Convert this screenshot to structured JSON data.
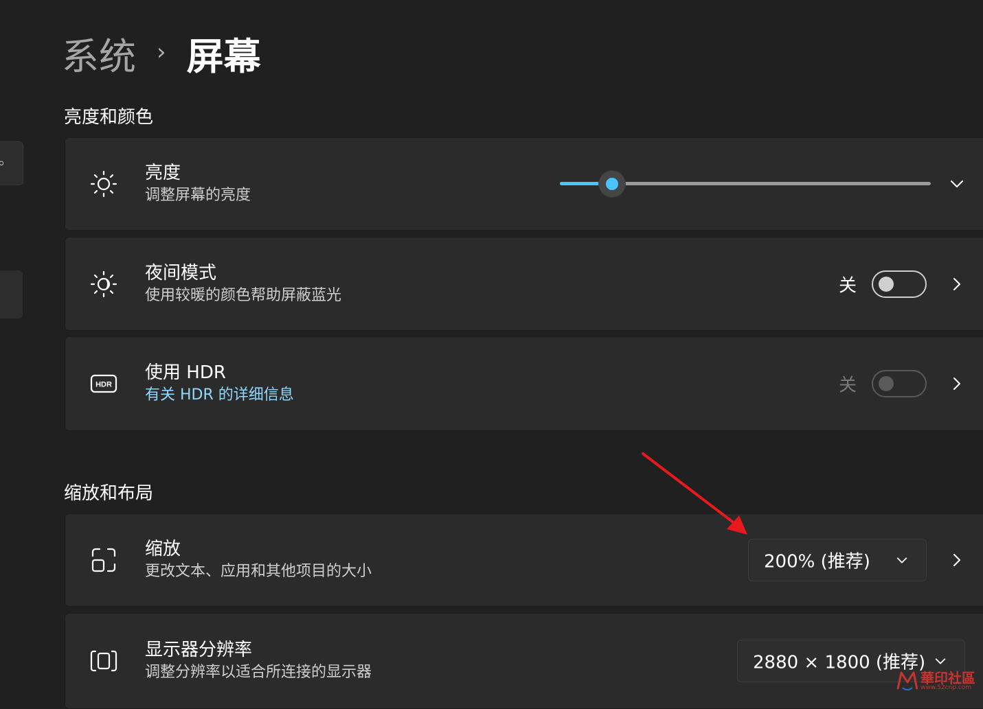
{
  "breadcrumb": {
    "parent": "系统",
    "separator": "›",
    "current": "屏幕"
  },
  "sections": {
    "brightness_color": "亮度和颜色",
    "scale_layout": "缩放和布局"
  },
  "brightness": {
    "title": "亮度",
    "subtitle": "调整屏幕的亮度",
    "level_percent": 14
  },
  "night_light": {
    "title": "夜间模式",
    "subtitle": "使用较暖的颜色帮助屏蔽蓝光",
    "state_label": "关",
    "on": false
  },
  "hdr": {
    "title": "使用 HDR",
    "link": "有关 HDR 的详细信息",
    "state_label": "关",
    "on": false,
    "enabled": false
  },
  "scale": {
    "title": "缩放",
    "subtitle": "更改文本、应用和其他项目的大小",
    "selected": "200% (推荐)"
  },
  "resolution": {
    "title": "显示器分辨率",
    "subtitle": "调整分辨率以适合所连接的显示器",
    "selected": "2880 × 1800 (推荐)"
  },
  "watermark": {
    "text": "華印社區",
    "url": "www.52cnp.com"
  },
  "colors": {
    "accent": "#4cc2ff",
    "background": "#202020",
    "card": "#2b2b2b",
    "annotation_arrow": "#e8191b"
  }
}
